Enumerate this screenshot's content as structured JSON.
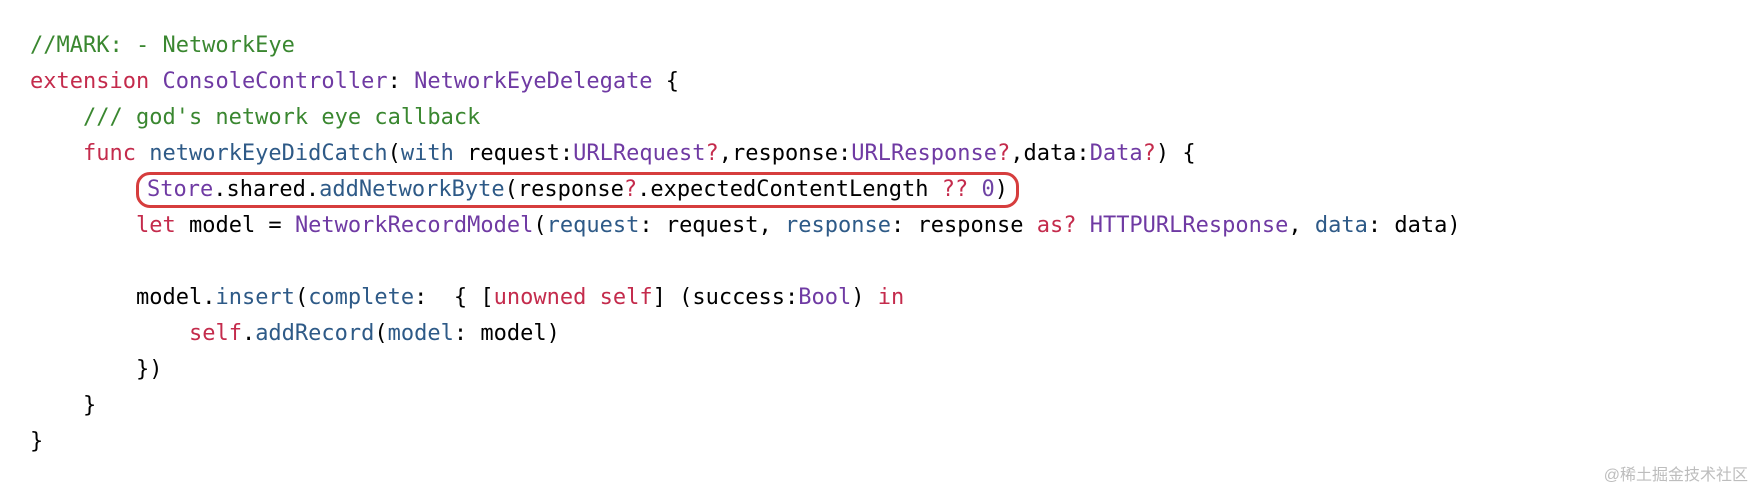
{
  "code": {
    "l1_comment": "//MARK: - NetworkEye",
    "l2_ext": "extension",
    "l2_type1": "ConsoleController",
    "l2_colon": ": ",
    "l2_type2": "NetworkEyeDelegate",
    "l2_brace": " {",
    "l3_comment": "/// god's network eye callback",
    "l4_func": "func",
    "l4_name": "networkEyeDidCatch",
    "l4_p_with": "with",
    "l4_req_lbl": " request:",
    "l4_urlreq": "URLRequest",
    "l4_q": "?",
    "l4_resp_lbl": ",response:",
    "l4_urlresp": "URLResponse",
    "l4_data_lbl": ",data:",
    "l4_data_t": "Data",
    "l4_tail": ") {",
    "l5_store": "Store",
    "l5_shared": ".shared.",
    "l5_add": "addNetworkByte",
    "l5_open": "(response",
    "l5_q": "?",
    "l5_prop": ".expectedContentLength ",
    "l5_nil": "??",
    "l5_num": " 0",
    "l5_close": ")",
    "l6_let": "let",
    "l6_model": " model = ",
    "l6_nrm": "NetworkRecordModel",
    "l6_open": "(",
    "l6_req": "request",
    "l6_req_v": ": request, ",
    "l6_resp": "response",
    "l6_resp_v": ": response ",
    "l6_as": "as?",
    "l6_http": " HTTPURLResponse",
    "l6_data": ", ",
    "l6_data_lbl": "data",
    "l6_data_v": ": data)",
    "l8_model": "model.",
    "l8_insert": "insert",
    "l8_open": "(",
    "l8_complete": "complete",
    "l8_mid": ":  { [",
    "l8_unowned": "unowned",
    "l8_self": " self",
    "l8_mid2": "] (success:",
    "l8_bool": "Bool",
    "l8_close": ") ",
    "l8_in": "in",
    "l9_self": "self",
    "l9_dot": ".",
    "l9_add": "addRecord",
    "l9_open": "(",
    "l9_model": "model",
    "l9_tail": ": model)",
    "l10": "})",
    "l11": "}",
    "l12": "}"
  },
  "watermark": "@稀土掘金技术社区"
}
